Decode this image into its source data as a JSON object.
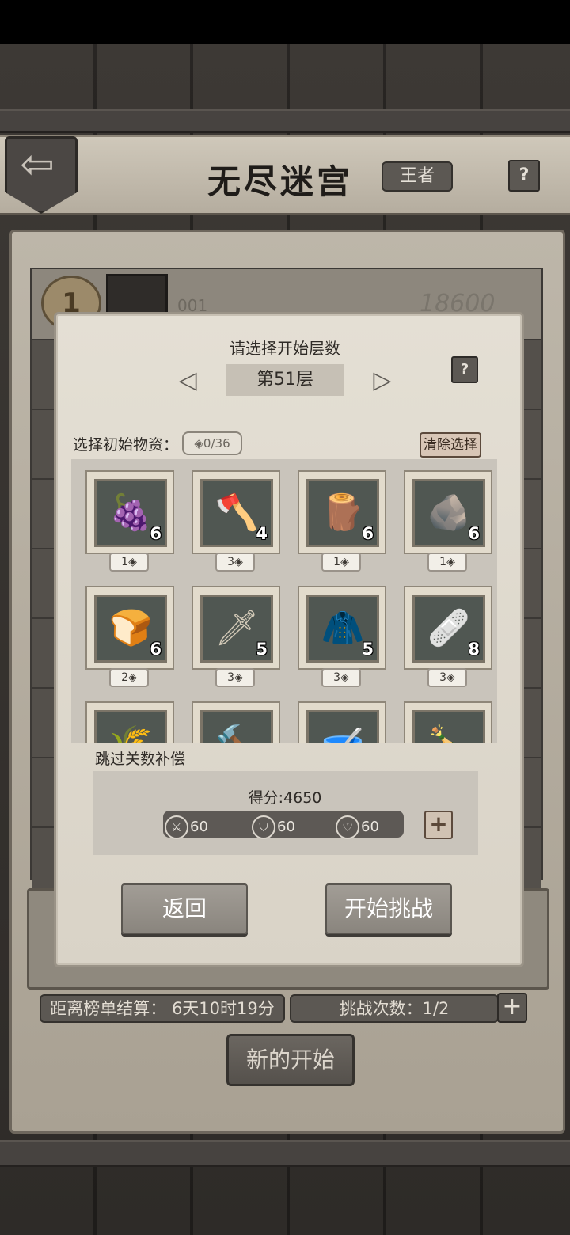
{
  "header": {
    "title": "无尽迷宫",
    "rank_badge": "王者",
    "help": "?"
  },
  "leaderboard": {
    "rank": "1",
    "player_id": "001",
    "score": "18600"
  },
  "footer": {
    "timer_label": "距离榜单结算：",
    "timer_value": "6天10时19分",
    "attempts_label": "挑战次数：",
    "attempts_value": "1/2",
    "restart": "新的开始"
  },
  "modal": {
    "title": "请选择开始层数",
    "floor": "第51层",
    "help": "?",
    "supply_label": "选择初始物资：",
    "supply_counter": "0/36",
    "clear_button": "清除选择",
    "items": [
      {
        "name": "berries",
        "icon": "berries-icon",
        "glyph": "🍇",
        "count": "6",
        "cost": "1"
      },
      {
        "name": "axe",
        "icon": "axe-icon",
        "glyph": "🪓",
        "count": "4",
        "cost": "3"
      },
      {
        "name": "wood",
        "icon": "wood-icon",
        "glyph": "🪵",
        "count": "6",
        "cost": "1"
      },
      {
        "name": "stone",
        "icon": "stone-icon",
        "glyph": "🪨",
        "count": "6",
        "cost": "1"
      },
      {
        "name": "bread",
        "icon": "bread-icon",
        "glyph": "🍞",
        "count": "6",
        "cost": "2"
      },
      {
        "name": "spear",
        "icon": "spear-icon",
        "glyph": "🗡",
        "count": "5",
        "cost": "3"
      },
      {
        "name": "jacket",
        "icon": "jacket-icon",
        "glyph": "🧥",
        "count": "5",
        "cost": "3"
      },
      {
        "name": "bandage",
        "icon": "bandage-icon",
        "glyph": "🩹",
        "count": "8",
        "cost": "3"
      },
      {
        "name": "grain",
        "icon": "grain-sack-icon",
        "glyph": "🌾",
        "count": "",
        "cost": ""
      },
      {
        "name": "hammer",
        "icon": "hammer-icon",
        "glyph": "🔨",
        "count": "",
        "cost": ""
      },
      {
        "name": "bowl",
        "icon": "bowl-icon",
        "glyph": "🥣",
        "count": "",
        "cost": ""
      },
      {
        "name": "bottle",
        "icon": "bottle-icon",
        "glyph": "🍾",
        "count": "",
        "cost": ""
      }
    ],
    "skip_label": "跳过关数补偿",
    "score_text": "得分:4650",
    "stats": {
      "attack": "60",
      "defense": "60",
      "health": "60"
    },
    "back_button": "返回",
    "start_button": "开始挑战"
  }
}
